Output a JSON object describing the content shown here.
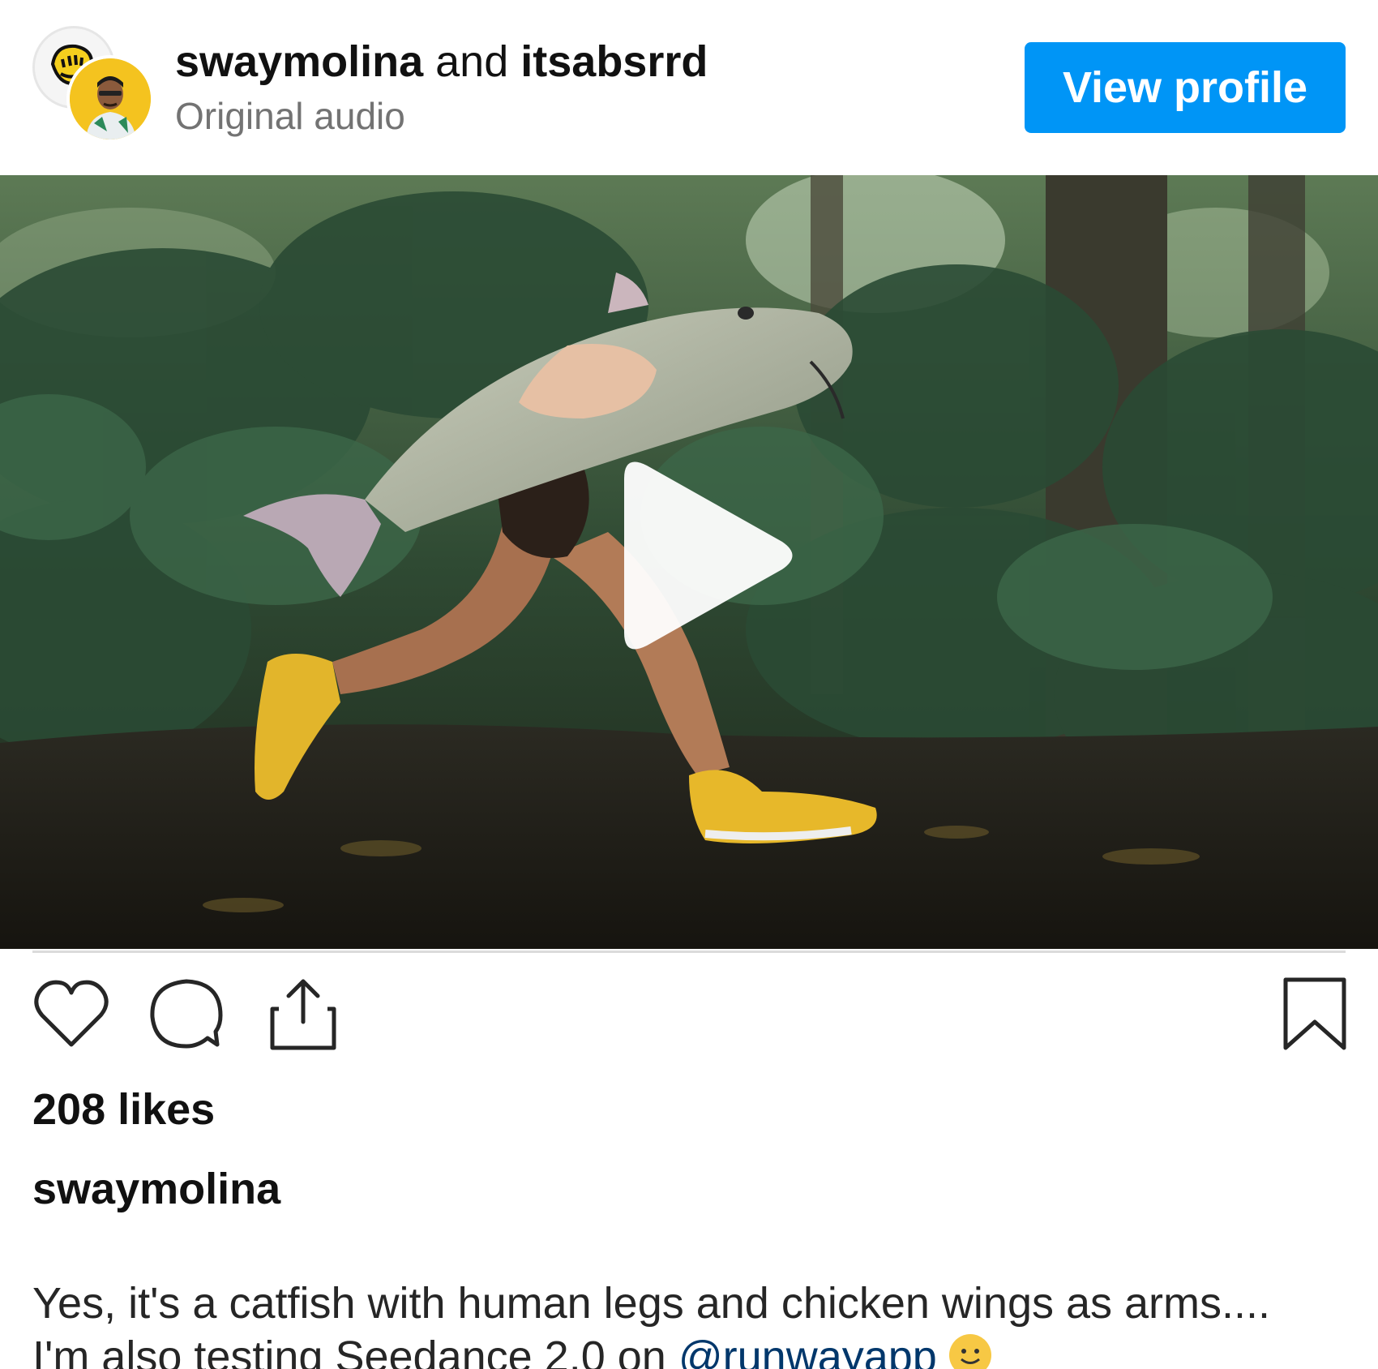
{
  "header": {
    "user1": "swaymolina",
    "connector": "and",
    "user2": "itsabsrrd",
    "subtitle": "Original audio",
    "view_profile_label": "View profile"
  },
  "post": {
    "likes": "208 likes",
    "caption_user": "swaymolina",
    "caption_line1": "Yes, it's a catfish with human legs and chicken wings as arms....",
    "caption_line2_prefix": "I'm also testing Seedance 2.0 on ",
    "caption_mention": "@runwayapp"
  },
  "icons": {
    "like": "heart-icon",
    "comment": "comment-icon",
    "share": "share-icon",
    "save": "bookmark-icon",
    "play": "play-icon",
    "emoji": "smiling-face-emoji"
  },
  "colors": {
    "primary_button": "#0095f6",
    "secondary_text": "#737373",
    "mention": "#00376b"
  }
}
